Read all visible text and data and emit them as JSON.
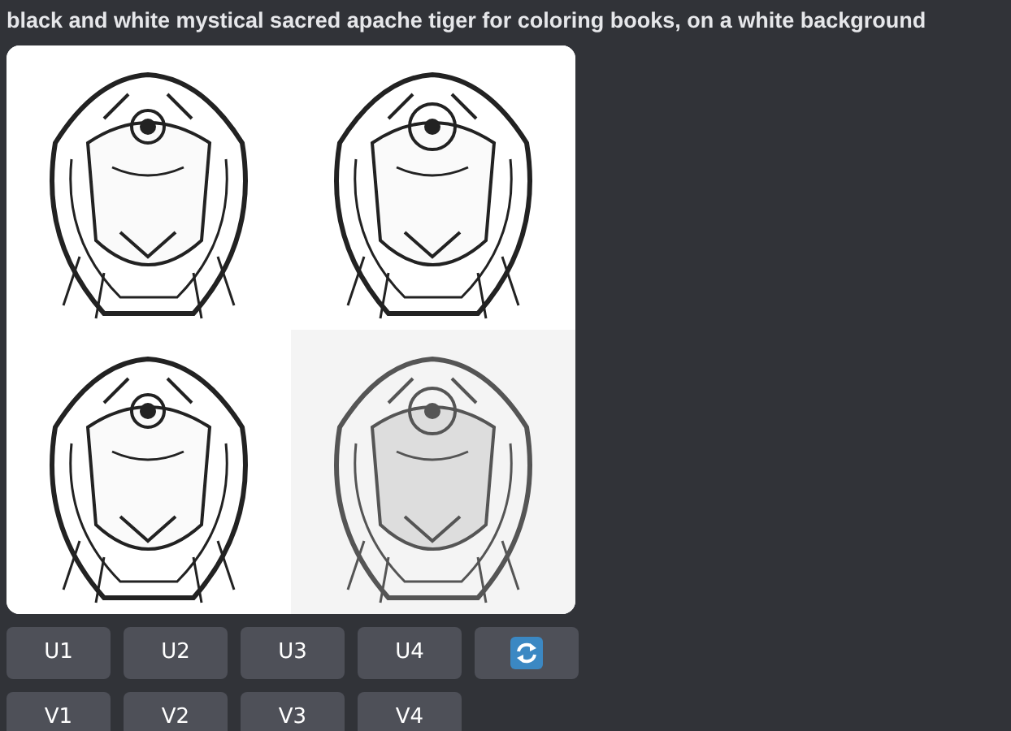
{
  "prompt": "black and white mystical sacred apache tiger for coloring books, on a white background",
  "images": [
    {
      "kind": "picture"
    },
    {
      "kind": "picture"
    },
    {
      "kind": "picture"
    },
    {
      "kind": "picture"
    }
  ],
  "button_rows": [
    [
      {
        "kind": "text",
        "label": "U1"
      },
      {
        "kind": "text",
        "label": "U2"
      },
      {
        "kind": "text",
        "label": "U3"
      },
      {
        "kind": "text",
        "label": "U4"
      },
      {
        "kind": "refresh"
      }
    ],
    [
      {
        "kind": "text",
        "label": "V1"
      },
      {
        "kind": "text",
        "label": "V2"
      },
      {
        "kind": "text",
        "label": "V3"
      },
      {
        "kind": "text",
        "label": "V4"
      }
    ]
  ]
}
